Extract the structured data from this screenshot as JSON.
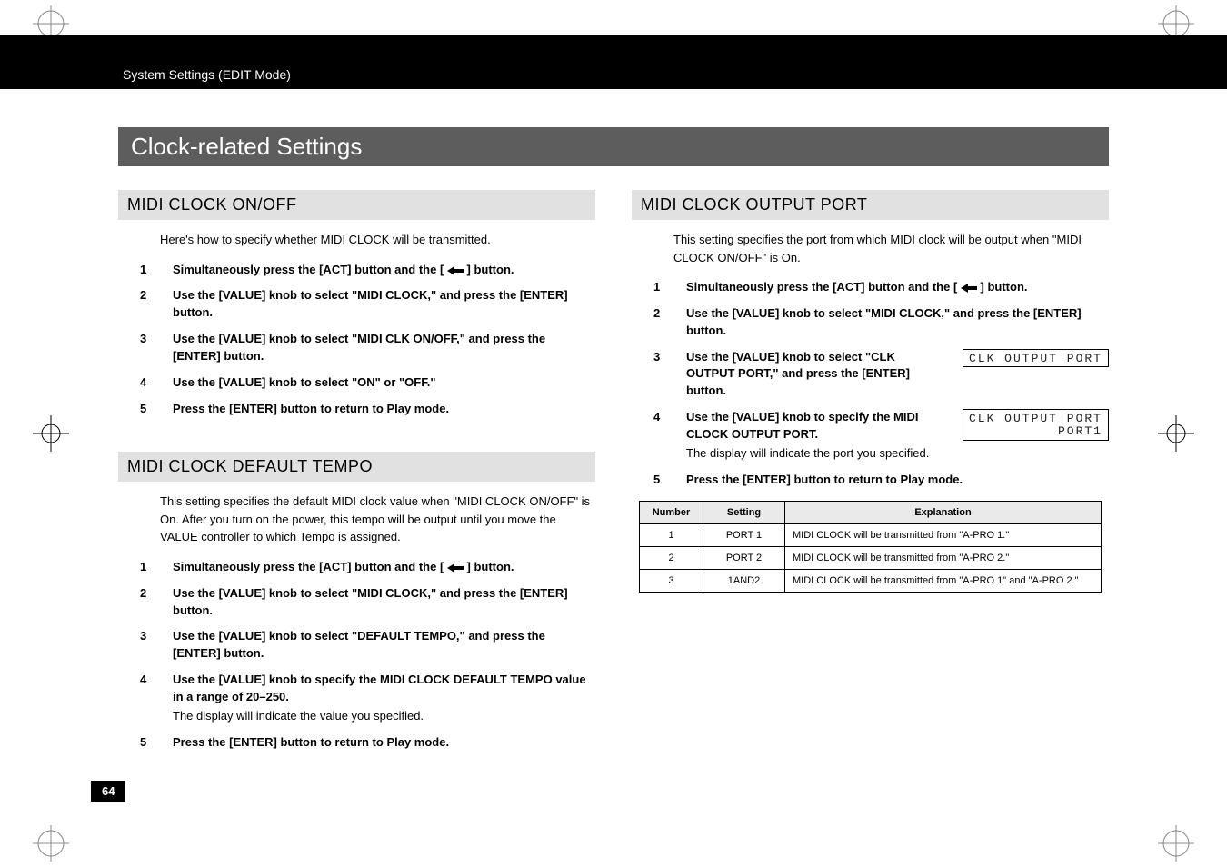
{
  "breadcrumb": "System Settings (EDIT Mode)",
  "title": "Clock-related Settings",
  "page_number": "64",
  "left": {
    "s1": {
      "head": "MIDI CLOCK ON/OFF",
      "intro": "Here's how to specify whether MIDI CLOCK will be transmitted.",
      "steps": [
        {
          "pre": "Simultaneously press the [ACT] button and the [ ",
          "post": " ] button."
        },
        {
          "full": "Use the [VALUE] knob to select \"MIDI CLOCK,\" and press the [ENTER] button."
        },
        {
          "full": "Use the [VALUE] knob to select \"MIDI CLK ON/OFF,\" and press the [ENTER] button."
        },
        {
          "full": "Use the [VALUE] knob to select \"ON\" or \"OFF.\""
        },
        {
          "full": "Press the [ENTER] button to return to Play mode."
        }
      ]
    },
    "s2": {
      "head": "MIDI CLOCK DEFAULT TEMPO",
      "intro": "This setting specifies the default MIDI clock value when \"MIDI CLOCK ON/OFF\" is On. After you turn on the power, this tempo will be output until you move the VALUE controller to which Tempo is assigned.",
      "steps": [
        {
          "pre": "Simultaneously press the [ACT] button and the [ ",
          "post": " ] button."
        },
        {
          "full": "Use the [VALUE] knob to select \"MIDI CLOCK,\" and press the [ENTER] button."
        },
        {
          "full": "Use the [VALUE] knob to select \"DEFAULT TEMPO,\" and press the [ENTER] button."
        },
        {
          "full": "Use the [VALUE] knob to specify the MIDI CLOCK DEFAULT TEMPO value in a range of 20–250.",
          "note": "The display will indicate the value you specified."
        },
        {
          "full": "Press the [ENTER] button to return to Play mode."
        }
      ]
    }
  },
  "right": {
    "s1": {
      "head": "MIDI CLOCK OUTPUT PORT",
      "intro": "This setting specifies the port from which MIDI clock will be output when \"MIDI CLOCK ON/OFF\" is On.",
      "steps": [
        {
          "pre": "Simultaneously press the [ACT] button and the [ ",
          "post": " ] button."
        },
        {
          "full": "Use the [VALUE] knob to select \"MIDI CLOCK,\" and press the [ENTER] button."
        },
        {
          "full": "Use the [VALUE] knob to select \"CLK OUTPUT PORT,\" and press the [ENTER] button.",
          "lcd": "CLK OUTPUT PORT"
        },
        {
          "full": "Use the [VALUE] knob to specify the MIDI CLOCK OUTPUT PORT.",
          "note": "The display will indicate the port you specified.",
          "lcd": "CLK OUTPUT PORT\n          PORT1"
        },
        {
          "full": "Press the [ENTER] button to return to Play mode."
        }
      ],
      "table": {
        "headers": [
          "Number",
          "Setting",
          "Explanation"
        ],
        "rows": [
          [
            "1",
            "PORT 1",
            "MIDI CLOCK will be transmitted from \"A-PRO 1.\""
          ],
          [
            "2",
            "PORT 2",
            "MIDI CLOCK will be transmitted from \"A-PRO 2.\""
          ],
          [
            "3",
            "1AND2",
            "MIDI CLOCK will be transmitted from \"A-PRO 1\" and \"A-PRO 2.\""
          ]
        ]
      }
    }
  }
}
